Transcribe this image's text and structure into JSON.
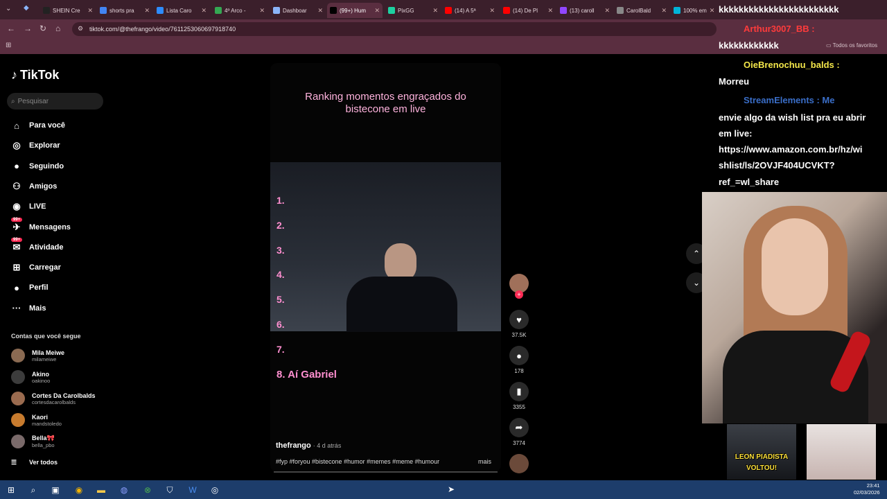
{
  "browser": {
    "tabs": [
      {
        "label": "SHEIN Cre",
        "color": "#222"
      },
      {
        "label": "shorts pra",
        "color": "#4285f4"
      },
      {
        "label": "Lista Caro",
        "color": "#2d8cff"
      },
      {
        "label": "4º Arco -",
        "color": "#34a853"
      },
      {
        "label": "Dashboar",
        "color": "#8ab4f8"
      },
      {
        "label": "(99+) Hum",
        "color": "#000",
        "active": true
      },
      {
        "label": "PixGG",
        "color": "#1dd1a1"
      },
      {
        "label": "(14) A 5ª",
        "color": "#ff0000"
      },
      {
        "label": "(14) De Pl",
        "color": "#ff0000"
      },
      {
        "label": "(13) caroll",
        "color": "#9146ff"
      },
      {
        "label": "CarolBald",
        "color": "#888"
      },
      {
        "label": "100% em",
        "color": "#00b4d8"
      }
    ],
    "url": "tiktok.com/@thefrango/video/7611253060697918740",
    "favorites_label": "Todos os favoritos"
  },
  "tiktok": {
    "brand": "TikTok",
    "search_placeholder": "Pesquisar",
    "nav": [
      {
        "label": "Para você",
        "icon": "home-icon",
        "glyph": "⌂"
      },
      {
        "label": "Explorar",
        "icon": "compass-icon",
        "glyph": "◎"
      },
      {
        "label": "Seguindo",
        "icon": "following-avatar-icon",
        "glyph": "●"
      },
      {
        "label": "Amigos",
        "icon": "friends-icon",
        "glyph": "⚇"
      },
      {
        "label": "LIVE",
        "icon": "live-icon",
        "glyph": "◉"
      },
      {
        "label": "Mensagens",
        "icon": "messages-icon",
        "glyph": "✈",
        "badge": "99+"
      },
      {
        "label": "Atividade",
        "icon": "activity-icon",
        "glyph": "✉",
        "badge": "99+"
      },
      {
        "label": "Carregar",
        "icon": "upload-icon",
        "glyph": "⊞"
      },
      {
        "label": "Perfil",
        "icon": "profile-avatar-icon",
        "glyph": "●"
      },
      {
        "label": "Mais",
        "icon": "more-icon",
        "glyph": "···"
      }
    ],
    "following_title": "Contas que você segue",
    "accounts": [
      {
        "name": "Mila Meiwe",
        "handle": "milameiwe"
      },
      {
        "name": "Akino",
        "handle": "oakinoo"
      },
      {
        "name": "Cortes Da Carolbalds",
        "handle": "cortesdacarolbalds"
      },
      {
        "name": "Kaori",
        "handle": "mandstoledo"
      },
      {
        "name": "Bella🎀",
        "handle": "bella_pbo"
      }
    ],
    "see_all": "Ver todos"
  },
  "video": {
    "title_line1": "Ranking momentos engraçados do",
    "title_line2": "bistecone em live",
    "ranks": [
      "1.",
      "2.",
      "3.",
      "4.",
      "5.",
      "6.",
      "7.",
      "8. Aí Gabriel"
    ],
    "author": "thefrango",
    "time": "· 4 d atrás",
    "tags": "#fyp #foryou #bistecone #humor #memes #meme #humour",
    "more": "mais",
    "likes": "37.5K",
    "comments": "178",
    "saves": "3355",
    "shares": "3774"
  },
  "stream": {
    "lines": [
      {
        "text": "kkkkkkkkkkkkkkkkkkkkkkkk",
        "color": "#ffffff"
      },
      {
        "text": "Arthur3007_BB :",
        "color": "#ff3b3b"
      },
      {
        "text": "kkkkkkkkkkkk",
        "color": "#ffffff"
      },
      {
        "text": "OieBrenochuu_balds :",
        "color": "#f5e84a"
      },
      {
        "text": "Morreu",
        "color": "#ffffff"
      },
      {
        "text": "StreamElements : Me",
        "color": "#3a6ec8"
      },
      {
        "text": "envie algo da wish list pra eu abrir",
        "color": "#ffffff"
      },
      {
        "text": "em live:",
        "color": "#ffffff"
      },
      {
        "text": "https://www.amazon.com.br/hz/wi",
        "color": "#ffffff"
      },
      {
        "text": "shlist/ls/2OVJF404UCVKT?",
        "color": "#ffffff"
      },
      {
        "text": "ref_=wl_share",
        "color": "#ffffff"
      }
    ],
    "thumb_label_1": "LEON PIADISTA",
    "thumb_label_2": "VOLTOU!"
  },
  "taskbar": {
    "time": "23:41",
    "date": "02/03/2026"
  }
}
